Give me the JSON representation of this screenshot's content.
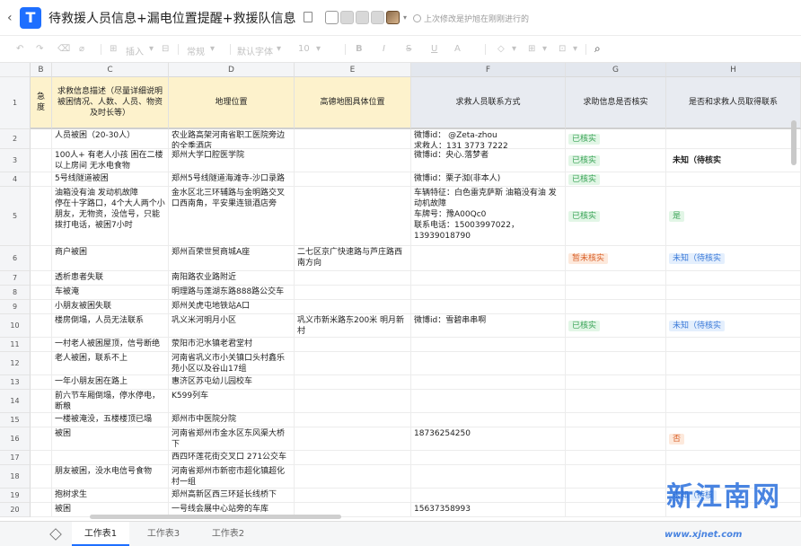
{
  "titlebar": {
    "title": "待救援人员信息+漏电位置提醒+救援队信息",
    "save_status": "上次修改是护旭在刚刚进行的"
  },
  "toolbar": {
    "insert": "插入",
    "format": "常规",
    "font": "默认字体",
    "size": "10"
  },
  "columns": [
    {
      "letter": "B",
      "header": "急度",
      "style": "yellow"
    },
    {
      "letter": "C",
      "header": "求救信息描述（尽量详细说明被困情况、人数、人员、物资及时长等）",
      "style": "yellow"
    },
    {
      "letter": "D",
      "header": "地理位置",
      "style": "yellow"
    },
    {
      "letter": "E",
      "header": "高德地图具体位置",
      "style": "yellow"
    },
    {
      "letter": "F",
      "header": "求救人员联系方式",
      "style": "grey"
    },
    {
      "letter": "G",
      "header": "求助信息是否核实",
      "style": "grey"
    },
    {
      "letter": "H",
      "header": "是否和求救人员取得联系",
      "style": "grey"
    }
  ],
  "rows": [
    {
      "n": "1"
    },
    {
      "n": "2",
      "C": "人员被困（20-30人）",
      "D": "农业路高架河南省职工医院旁边的全季酒店",
      "E": "",
      "F": "微博id： @Zeta-zhou\n求救人：131 3773 7222",
      "G": "已核实",
      "G_style": "green",
      "H": ""
    },
    {
      "n": "3",
      "C": "100人+ 有老人小孩 困在二楼以上房间 无水电食物",
      "D": "郑州大学口腔医学院",
      "E": "",
      "F": "微博id：央心.落梦者",
      "G": "已核实",
      "G_style": "green",
      "H": "未知（待核实",
      "H_style": "plain"
    },
    {
      "n": "4",
      "C": "5号线隧道被困",
      "D": "郑州5号线隧道海滩寺-沙口录路",
      "E": "",
      "F": "微博id：栗子洳(非本人)",
      "G": "已核实",
      "G_style": "green",
      "H": ""
    },
    {
      "n": "5",
      "C": "油箱没有油 发动机故障\n停在十字路口，4个大人两个小朋友，无物资，没信号，只能拨打电话，被困7小时",
      "D": "金水区北三环辅路与金明路交叉口西南角，平安果连锁酒店旁",
      "E": "",
      "F": "车辆特征：白色雷克萨斯 油箱没有油 发动机故障\n车牌号：豫A00Qc0\n联系电话：15003997022，13939018790",
      "G": "已核实",
      "G_style": "green",
      "H": "是",
      "H_style": "green"
    },
    {
      "n": "6",
      "C": "商户被困",
      "D": "郑州百荣世贸商城A座",
      "E": "二七区京广快速路与芦庄路西南方向",
      "F": "",
      "G": "暂未核实",
      "G_style": "orange",
      "H": "未知（待核实",
      "H_style": "blue"
    },
    {
      "n": "7",
      "C": "透析患者失联",
      "D": "南阳路农业路附近",
      "E": "",
      "F": "",
      "G": "",
      "H": ""
    },
    {
      "n": "8",
      "C": "车被淹",
      "D": "明理路与莲湖东路888路公交车",
      "E": "",
      "F": "",
      "G": "",
      "H": ""
    },
    {
      "n": "9",
      "C": "小朋友被困失联",
      "D": "郑州关虎屯地铁站A口",
      "E": "",
      "F": "",
      "G": "",
      "H": ""
    },
    {
      "n": "10",
      "C": "楼房倒塌，人员无法联系",
      "D": "巩义米河明月小区",
      "E": "巩义市新米路东200米 明月新村",
      "F": "微博id：雪碧串串啊",
      "G": "已核实",
      "G_style": "green",
      "H": "未知（待核实",
      "H_style": "blue"
    },
    {
      "n": "11",
      "C": "一村老人被困屋顶，信号断绝",
      "D": "荥阳市汜水镇老君堂村",
      "E": "",
      "F": "",
      "G": "",
      "H": ""
    },
    {
      "n": "12",
      "C": "老人被困，联系不上",
      "D": "河南省巩义市小关镇口头村鑫乐苑小区以及谷山17组",
      "E": "",
      "F": "",
      "G": "",
      "H": ""
    },
    {
      "n": "13",
      "C": "一年小朋友困在路上",
      "D": "惠济区苏屯幼儿园校车",
      "E": "",
      "F": "",
      "G": "",
      "H": ""
    },
    {
      "n": "14",
      "C": "前六节车厢倒塌，停水停电，断粮",
      "D": "K599列车",
      "E": "",
      "F": "",
      "G": "",
      "H": ""
    },
    {
      "n": "15",
      "C": "一楼被淹没，五楼楼顶已塌",
      "D": "郑州市中医院分院",
      "E": "",
      "F": "",
      "G": "",
      "H": ""
    },
    {
      "n": "16",
      "C": "被困",
      "D": "河南省郑州市金水区东风渠大桥下",
      "E": "",
      "F": "18736254250",
      "G": "",
      "H": "否",
      "H_style": "orange"
    },
    {
      "n": "17",
      "C": "",
      "D": "西四环莲花街交叉口 271公交车",
      "E": "",
      "F": "",
      "G": "",
      "H": ""
    },
    {
      "n": "18",
      "C": "朋友被困，没水电信号食物",
      "D": "河南省郑州市新密市超化镇超化村一组",
      "E": "",
      "F": "",
      "G": "",
      "H": ""
    },
    {
      "n": "19",
      "C": "抱树求生",
      "D": "郑州高新区西三环延长线桥下",
      "E": "",
      "F": "",
      "G": "",
      "H": "未知（待核",
      "H_style": "blue"
    },
    {
      "n": "20",
      "C": "被困",
      "D": "一号线会展中心站旁的车库",
      "E": "",
      "F": "15637358993",
      "G": "",
      "H": ""
    }
  ],
  "sheet_tabs": [
    "工作表1",
    "工作表3",
    "工作表2"
  ],
  "watermark": {
    "text": "新江南网",
    "url": "www.xjnet.com"
  }
}
